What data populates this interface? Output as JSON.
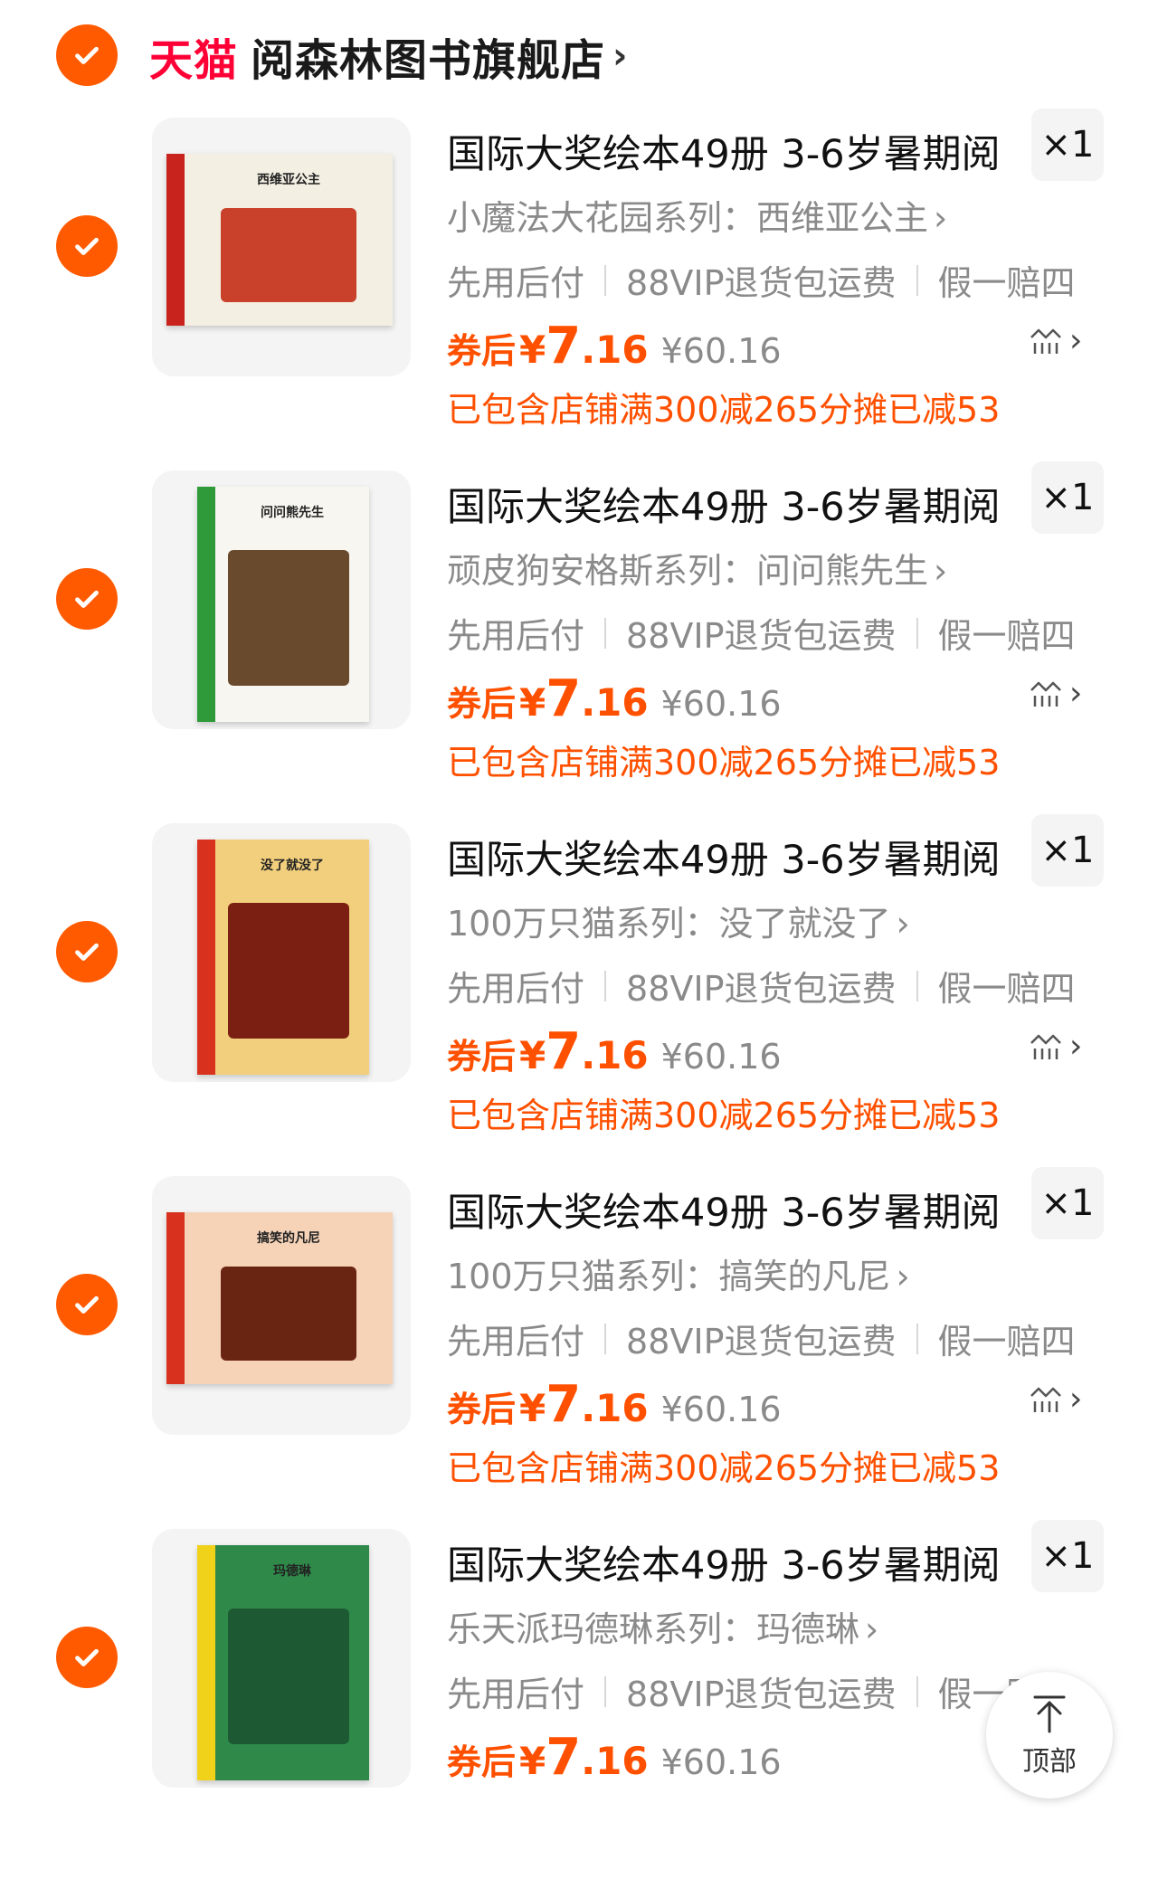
{
  "shop": {
    "brand": "天猫",
    "name": "阅森林图书旗舰店",
    "arrow": "›"
  },
  "items": [
    {
      "title": "国际大奖绘本49册 3-6岁暑期阅",
      "quantity": "×1",
      "variant": "小魔法大花园系列：西维亚公主",
      "services": [
        "先用后付",
        "88VIP退货包运费",
        "假一赔四"
      ],
      "coupon_label": "券后",
      "currency": "¥",
      "price_int": "7",
      "price_dec": ".16",
      "original_price": "¥60.16",
      "promo": "已包含店铺满300减265分摊已减53",
      "cover_title": "西维亚公主",
      "cover_colors": {
        "spine": "#c8231c",
        "cover": "#f3efe3",
        "art": "#c9402b"
      }
    },
    {
      "title": "国际大奖绘本49册 3-6岁暑期阅",
      "quantity": "×1",
      "variant": "顽皮狗安格斯系列：问问熊先生",
      "services": [
        "先用后付",
        "88VIP退货包运费",
        "假一赔四"
      ],
      "coupon_label": "券后",
      "currency": "¥",
      "price_int": "7",
      "price_dec": ".16",
      "original_price": "¥60.16",
      "promo": "已包含店铺满300减265分摊已减53",
      "cover_title": "问问熊先生",
      "cover_colors": {
        "spine": "#2f9a3a",
        "cover": "#f7f6f0",
        "art": "#6a4a2c"
      }
    },
    {
      "title": "国际大奖绘本49册 3-6岁暑期阅",
      "quantity": "×1",
      "variant": "100万只猫系列：没了就没了",
      "services": [
        "先用后付",
        "88VIP退货包运费",
        "假一赔四"
      ],
      "coupon_label": "券后",
      "currency": "¥",
      "price_int": "7",
      "price_dec": ".16",
      "original_price": "¥60.16",
      "promo": "已包含店铺满300减265分摊已减53",
      "cover_title": "没了就没了",
      "cover_colors": {
        "spine": "#d8321f",
        "cover": "#f2cf7c",
        "art": "#7a1f12"
      }
    },
    {
      "title": "国际大奖绘本49册 3-6岁暑期阅",
      "quantity": "×1",
      "variant": "100万只猫系列：搞笑的凡尼",
      "services": [
        "先用后付",
        "88VIP退货包运费",
        "假一赔四"
      ],
      "coupon_label": "券后",
      "currency": "¥",
      "price_int": "7",
      "price_dec": ".16",
      "original_price": "¥60.16",
      "promo": "已包含店铺满300减265分摊已减53",
      "cover_title": "搞笑的凡尼",
      "cover_colors": {
        "spine": "#d8321f",
        "cover": "#f6d3b7",
        "art": "#6a2412"
      }
    },
    {
      "title": "国际大奖绘本49册 3-6岁暑期阅",
      "quantity": "×1",
      "variant": "乐天派玛德琳系列：玛德琳",
      "services": [
        "先用后付",
        "88VIP退货包运费",
        "假一赔四"
      ],
      "coupon_label": "券后",
      "currency": "¥",
      "price_int": "7",
      "price_dec": ".16",
      "original_price": "¥60.16",
      "promo": "",
      "cover_title": "玛德琳",
      "cover_colors": {
        "spine": "#f0d21a",
        "cover": "#2f8a4a",
        "art": "#1d5a33"
      }
    }
  ],
  "back_to_top": {
    "label": "顶部"
  },
  "colors": {
    "accent": "#ff5000",
    "check": "#ff5a00",
    "tmall": "#ff0036"
  }
}
